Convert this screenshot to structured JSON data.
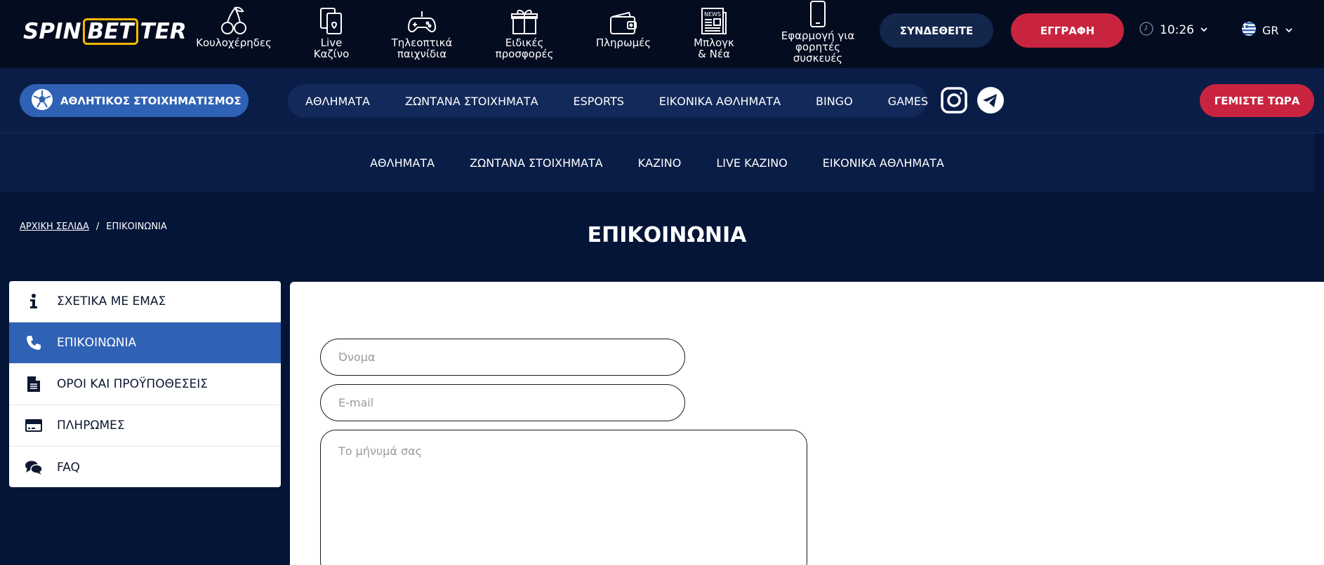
{
  "logo": {
    "part1": "SPIN",
    "part2": "BET",
    "part3": "TER"
  },
  "topnav": [
    {
      "id": "slots",
      "label": "Κουλοχέρηδες",
      "icon": "cherries-icon"
    },
    {
      "id": "live-casino",
      "label": "Live\nΚαζίνο",
      "icon": "playing-cards-icon"
    },
    {
      "id": "tv-games",
      "label": "Τηλεοπτικά\nπαιχνίδια",
      "icon": "gamepad-icon"
    },
    {
      "id": "promotions",
      "label": "Ειδικές\nπροσφορές",
      "icon": "gift-icon"
    },
    {
      "id": "payments",
      "label": "Πληρωμές",
      "icon": "wallet-icon"
    },
    {
      "id": "blog",
      "label": "Μπλογκ\n& Νέα",
      "icon": "news-icon"
    },
    {
      "id": "mobile-app",
      "label": "Εφαρμογή για\nφορητές\nσυσκευές",
      "icon": "smartphone-icon"
    }
  ],
  "news_icon_text": "NEWS",
  "header": {
    "login_label": "ΣΥΝΔΕΘΕΙΤΕ",
    "register_label": "ΕΓΓΡΑΦΗ",
    "time": "10:26",
    "language": "GR"
  },
  "secondbar": {
    "sport_label": "ΑΘΛΗΤΙΚΟΣ ΣΤΟΙΧΗΜΑΤΙΣΜΟΣ",
    "nav": [
      "ΑΘΛΗΜΑΤΑ",
      "ΖΩΝΤΑΝΑ ΣΤΟΙΧΗΜΑΤΑ",
      "ESPORTS",
      "ΕΙΚΟΝΙΚΑ ΑΘΛΗΜΑΤΑ",
      "BINGO",
      "GAMES"
    ],
    "deposit_label": "ΓΕΜΙΣΤΕ ΤΩΡΑ"
  },
  "subnav": [
    "ΑΘΛΗΜΑΤΑ",
    "ΖΩΝΤΑΝΑ ΣΤΟΙΧΗΜΑΤΑ",
    "ΚΑΖΙΝΟ",
    "LIVE ΚΑΖΙΝΟ",
    "ΕΙΚΟΝΙΚΑ ΑΘΛΗΜΑΤΑ"
  ],
  "breadcrumb": {
    "home": "ΑΡΧΙΚΗ ΣΕΛΙΔΑ",
    "separator": "/",
    "current": "ΕΠΙΚΟΙΝΩΝΙΑ"
  },
  "page_title": "ΕΠΙΚΟΙΝΩΝΙΑ",
  "sidebar": [
    {
      "label": "ΣΧΕΤΙΚΑ ΜΕ ΕΜΑΣ",
      "icon": "info-icon",
      "active": false
    },
    {
      "label": "ΕΠΙΚΟΙΝΩΝΙΑ",
      "icon": "phone-icon",
      "active": true
    },
    {
      "label": "ΟΡΟΙ ΚΑΙ ΠΡΟΫΠΟΘΕΣΕΙΣ",
      "icon": "document-icon",
      "active": false
    },
    {
      "label": "ΠΛΗΡΩΜΕΣ",
      "icon": "credit-card-icon",
      "active": false
    },
    {
      "label": "FAQ",
      "icon": "chat-bubbles-icon",
      "active": false
    }
  ],
  "form": {
    "name_placeholder": "Όνομα",
    "email_placeholder": "E-mail",
    "message_placeholder": "Το μήνυμά σας"
  },
  "colors": {
    "page_bg": "#051538",
    "topbar_bg": "#040c1f",
    "nav_bg": "#0a1d47",
    "accent_blue": "#2f62b5",
    "accent_red": "#c9243f",
    "logo_gold": "#f6b800"
  }
}
